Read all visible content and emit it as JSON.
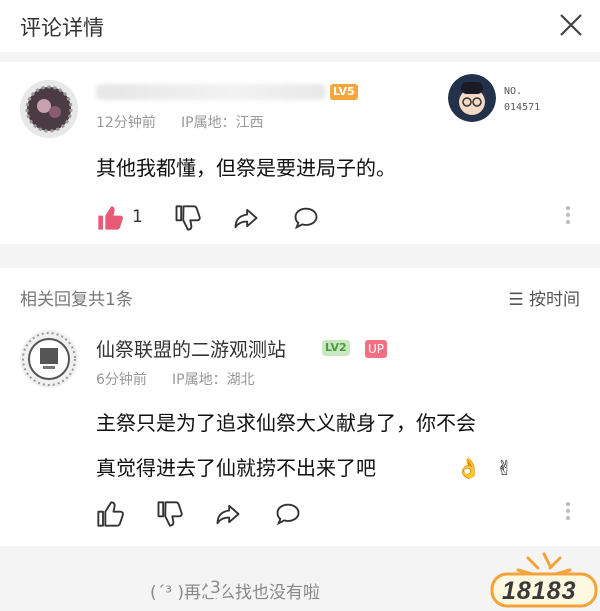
{
  "header": {
    "title": "评论详情",
    "close_icon": "close-icon"
  },
  "main_comment": {
    "level_badge": "LV5",
    "meta_time": "12分钟前",
    "meta_ip": "IP属地：江西",
    "text": "其他我都懂，但祭是要进局子的。",
    "like_count": "1",
    "no_label": "NO.",
    "no_value": "014571",
    "colors": {
      "like": "#e85a78"
    }
  },
  "replies_section": {
    "title": "相关回复共1条",
    "sort_label": "按时间"
  },
  "reply": {
    "username": "仙祭联盟的二游观测站",
    "level_badge": "LV2",
    "up_badge": "UP",
    "meta_time": "6分钟前",
    "meta_ip": "IP属地：湖北",
    "text_line1": "主祭只是为了追求仙祭大义献身了，你不会",
    "text_line2": "真觉得进去了仙就捞不出来了吧",
    "emoji": [
      "👌",
      "✌"
    ]
  },
  "footer": {
    "text": "(´³ )再怎么找也没有啦",
    "page": "3"
  },
  "watermark": {
    "text": "18183"
  }
}
